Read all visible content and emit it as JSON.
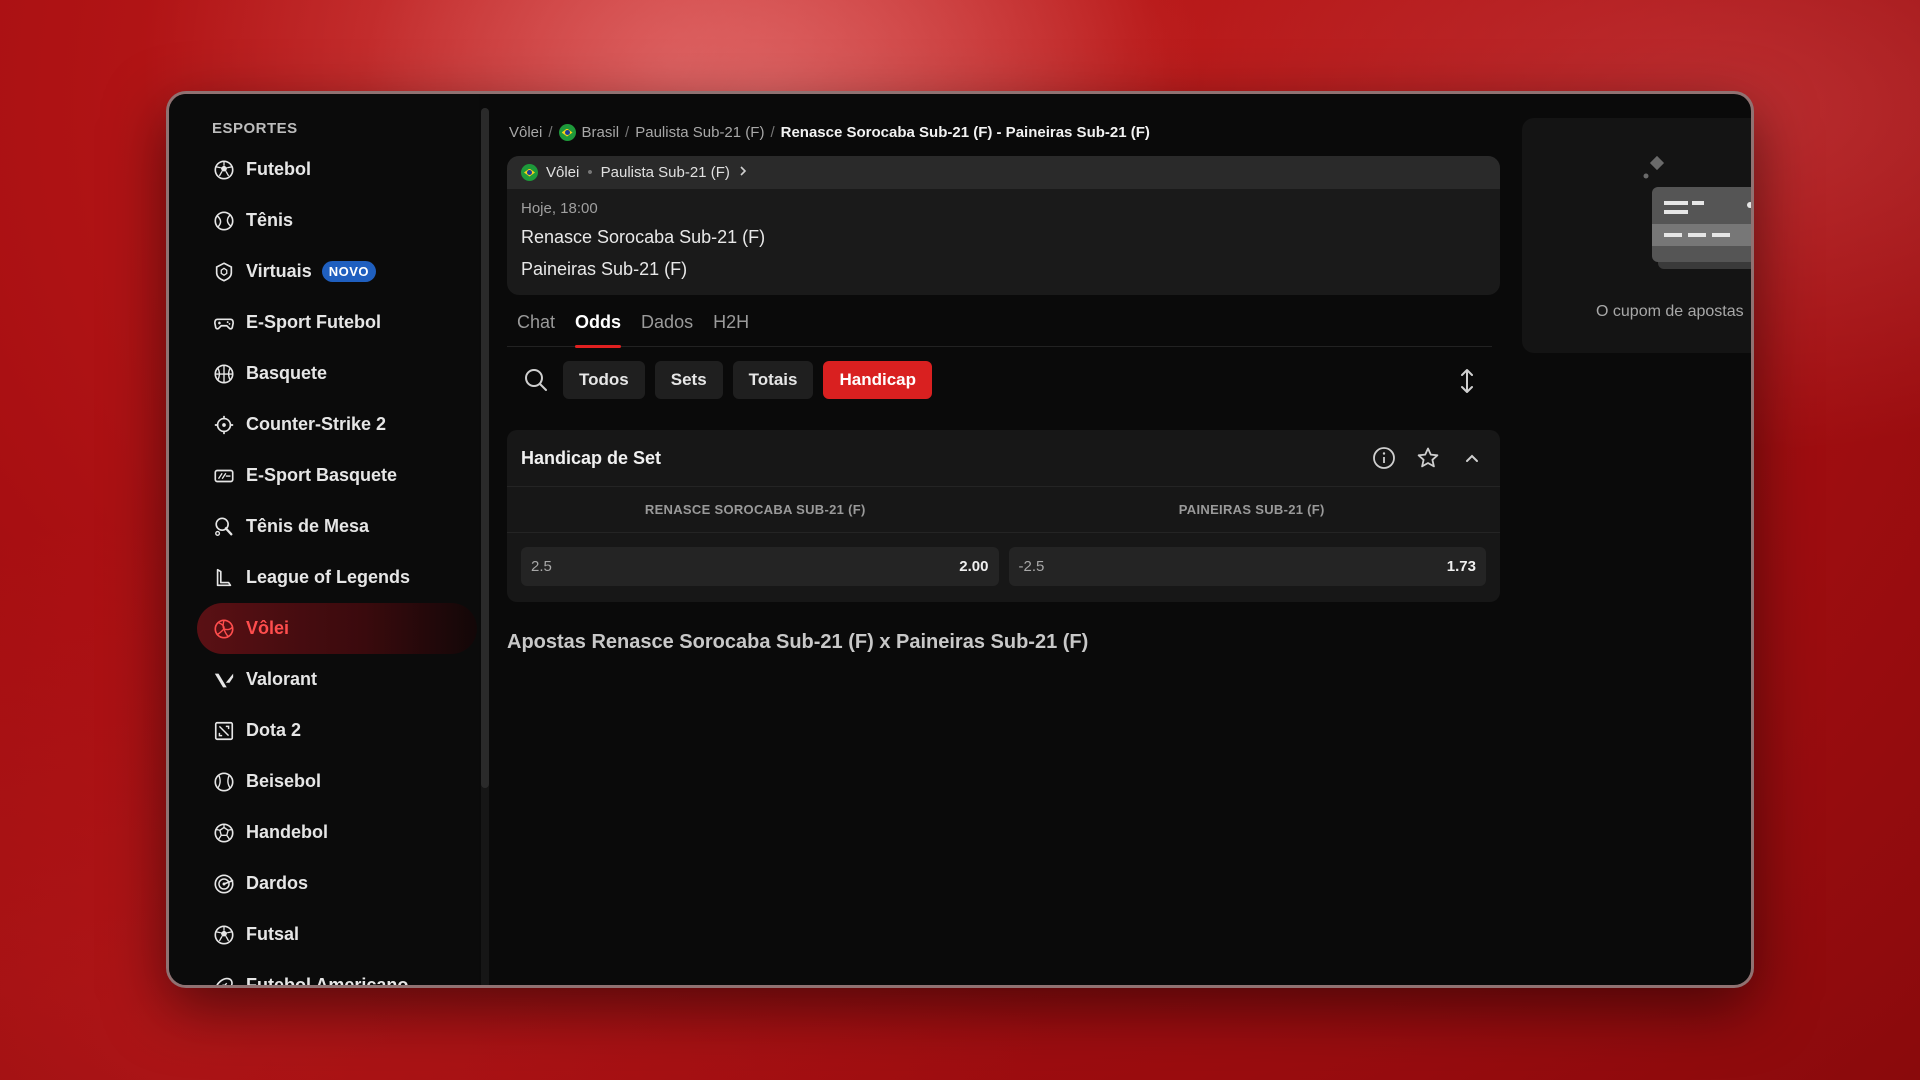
{
  "sidebar": {
    "heading": "ESPORTES",
    "items": [
      {
        "label": "Futebol",
        "icon": "soccer-ball-icon"
      },
      {
        "label": "Tênis",
        "icon": "tennis-ball-icon"
      },
      {
        "label": "Virtuais",
        "icon": "virtual-shield-icon",
        "badge": "NOVO"
      },
      {
        "label": "E-Sport Futebol",
        "icon": "gamepad-icon"
      },
      {
        "label": "Basquete",
        "icon": "basketball-icon"
      },
      {
        "label": "Counter-Strike 2",
        "icon": "crosshair-icon"
      },
      {
        "label": "E-Sport Basquete",
        "icon": "esport-basketball-icon"
      },
      {
        "label": "Tênis de Mesa",
        "icon": "table-tennis-icon"
      },
      {
        "label": "League of Legends",
        "icon": "lol-icon"
      },
      {
        "label": "Vôlei",
        "icon": "volleyball-icon",
        "active": true
      },
      {
        "label": "Valorant",
        "icon": "valorant-icon"
      },
      {
        "label": "Dota 2",
        "icon": "dota-icon"
      },
      {
        "label": "Beisebol",
        "icon": "baseball-icon"
      },
      {
        "label": "Handebol",
        "icon": "handball-icon"
      },
      {
        "label": "Dardos",
        "icon": "darts-icon"
      },
      {
        "label": "Futsal",
        "icon": "futsal-icon"
      },
      {
        "label": "Futebol Americano",
        "icon": "american-football-icon"
      }
    ]
  },
  "breadcrumb": {
    "sport": "Vôlei",
    "country": "Brasil",
    "league": "Paulista Sub-21 (F)",
    "match": "Renasce Sorocaba Sub-21 (F) - Paineiras Sub-21 (F)"
  },
  "match": {
    "sport": "Vôlei",
    "separator": "•",
    "league": "Paulista Sub-21 (F)",
    "time": "Hoje, 18:00",
    "team1": "Renasce Sorocaba Sub-21 (F)",
    "team2": "Paineiras Sub-21 (F)"
  },
  "tabs": [
    {
      "label": "Chat"
    },
    {
      "label": "Odds",
      "active": true
    },
    {
      "label": "Dados"
    },
    {
      "label": "H2H"
    }
  ],
  "filters": [
    {
      "label": "Todos"
    },
    {
      "label": "Sets"
    },
    {
      "label": "Totais"
    },
    {
      "label": "Handicap",
      "active": true
    }
  ],
  "market": {
    "title": "Handicap de Set",
    "col1": "RENASCE SOROCABA SUB-21 (F)",
    "col2": "PAINEIRAS SUB-21 (F)",
    "odds": [
      {
        "line": "2.5",
        "price": "2.00"
      },
      {
        "line": "-2.5",
        "price": "1.73"
      }
    ]
  },
  "section_title": "Apostas Renasce Sorocaba Sub-21 (F) x Paineiras Sub-21 (F)",
  "betslip": {
    "empty_text": "O cupom de apostas"
  },
  "colors": {
    "accent": "#d92020",
    "active_text": "#ff4d4d",
    "badge": "#1f5fbf"
  }
}
